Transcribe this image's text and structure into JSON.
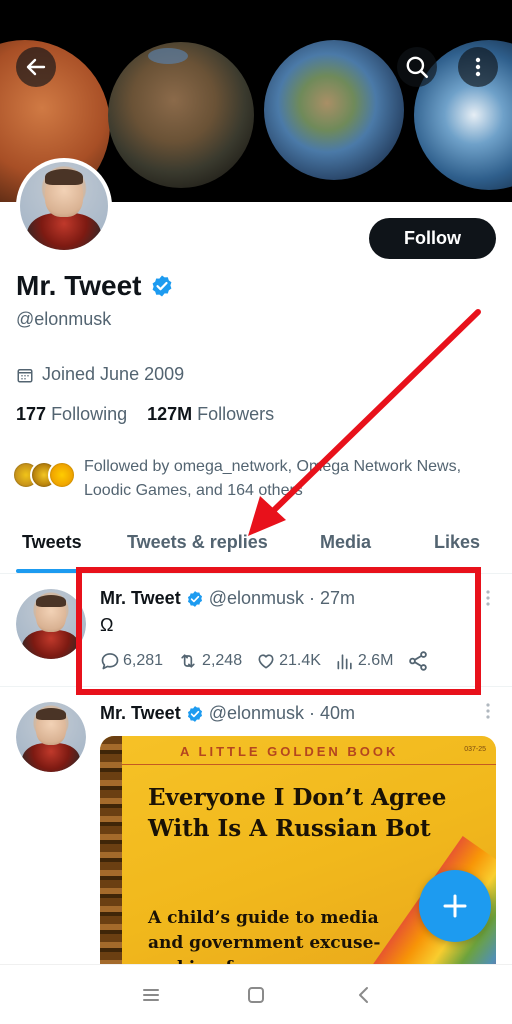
{
  "profile": {
    "display_name": "Mr. Tweet",
    "handle": "@elonmusk",
    "joined": "Joined June 2009",
    "following_count": "177",
    "following_label": "Following",
    "followers_count": "127M",
    "followers_label": "Followers",
    "followed_by": "Followed by omega_network, Omega Network News, Loodic Games, and 164 others",
    "follow_label": "Follow"
  },
  "tabs": [
    {
      "label": "Tweets",
      "active": true
    },
    {
      "label": "Tweets & replies",
      "active": false
    },
    {
      "label": "Media",
      "active": false
    },
    {
      "label": "Likes",
      "active": false
    }
  ],
  "tweets": [
    {
      "name": "Mr. Tweet",
      "meta": "@elonmusk · 27m",
      "text": "Ω",
      "replies": "6,281",
      "retweets": "2,248",
      "likes": "21.4K",
      "views": "2.6M"
    },
    {
      "name": "Mr. Tweet",
      "meta": "@elonmusk · 40m",
      "image": {
        "series": "A LITTLE GOLDEN BOOK",
        "number": "037-25",
        "title": "Everyone I Don’t Agree With Is A Russian Bot",
        "subtitle": "A child’s guide to media and government excuse-making for"
      }
    }
  ],
  "colors": {
    "accent": "#1d9bf0",
    "highlight": "#e8111b",
    "text": "#0f1419",
    "muted": "#536471"
  },
  "icons": {
    "back": "arrow-left-icon",
    "search": "search-icon",
    "more": "more-vertical-icon",
    "verified": "verified-badge-icon",
    "calendar": "calendar-icon",
    "reply": "reply-icon",
    "retweet": "retweet-icon",
    "like": "heart-icon",
    "views": "views-icon",
    "share": "share-icon",
    "compose": "plus-icon"
  }
}
